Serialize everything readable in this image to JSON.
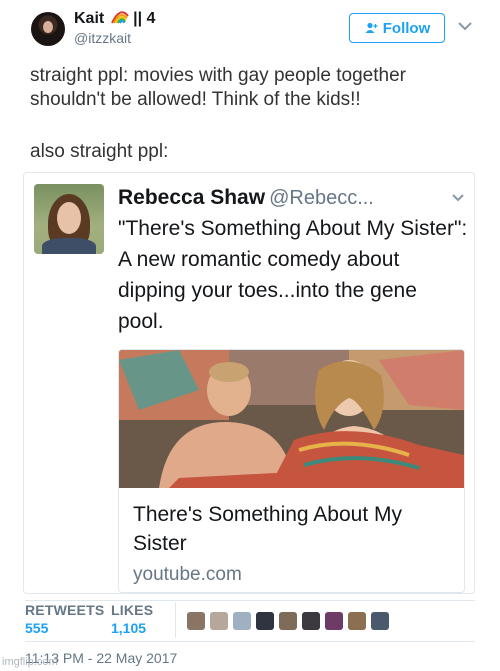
{
  "author": {
    "name": "Kait",
    "name_suffix": "|| 4",
    "handle": "@itzzkait",
    "avatar_icon": "user-avatar"
  },
  "follow_button": {
    "label": "Follow",
    "icon": "add-user-icon"
  },
  "tweet": {
    "text": "straight ppl: movies with gay people together shouldn't be allowed! Think of the kids!!",
    "text2": "also straight ppl:"
  },
  "quoted_tweet": {
    "name": "Rebecca Shaw",
    "handle": "@Rebecc...",
    "text": "\"There's Something About My Sister\": A new romantic comedy about dipping your toes...into the gene pool.",
    "card": {
      "title": "There's Something About My Sister",
      "domain": "youtube.com"
    }
  },
  "stats": {
    "retweets_label": "RETWEETS",
    "retweets_value": "555",
    "likes_label": "LIKES",
    "likes_value": "1,105"
  },
  "timestamp": "11:13 PM - 22 May 2017",
  "watermark": "imgflip.com",
  "colors": {
    "accent": "#1da1f2",
    "secondary_text": "#657786",
    "border": "#e1e8ed"
  }
}
